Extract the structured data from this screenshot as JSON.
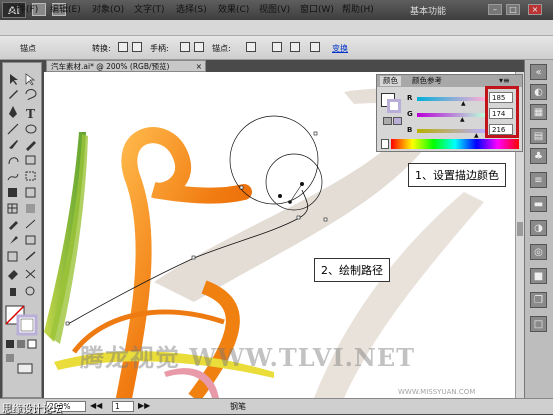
{
  "titlebar": {
    "logo": "Ai",
    "workspace": "基本功能",
    "win_min": "–",
    "win_max": "□",
    "win_close": "×"
  },
  "menu": [
    "文件(F)",
    "编辑(E)",
    "对象(O)",
    "文字(T)",
    "选择(S)",
    "效果(C)",
    "视图(V)",
    "窗口(W)",
    "帮助(H)"
  ],
  "controlbar": {
    "anchor_label": "锚点",
    "convert_label": "转换:",
    "handle_label": "手柄:",
    "anchor2_label": "锚点:",
    "convert_link": "变换"
  },
  "document": {
    "tab_title": "汽车素材.ai* @ 200% (RGB/预览)",
    "tab_close": "×"
  },
  "color_panel": {
    "tab_color": "颜色",
    "tab_guide": "颜色参考",
    "r_label": "R",
    "g_label": "G",
    "b_label": "B",
    "r_value": "185",
    "g_value": "174",
    "b_value": "216",
    "accent_red": "#c0141a"
  },
  "callouts": {
    "step1": "1、设置描边颜色",
    "step2": "2、绘制路径"
  },
  "statusbar": {
    "zoom": "200%",
    "page": "1",
    "tool": "钢笔"
  },
  "watermarks": {
    "left": "思缘设计论坛",
    "big": "腾龙视觉 WWW.TLVI.NET",
    "small": "WWW.MISSYUAN.COM"
  }
}
